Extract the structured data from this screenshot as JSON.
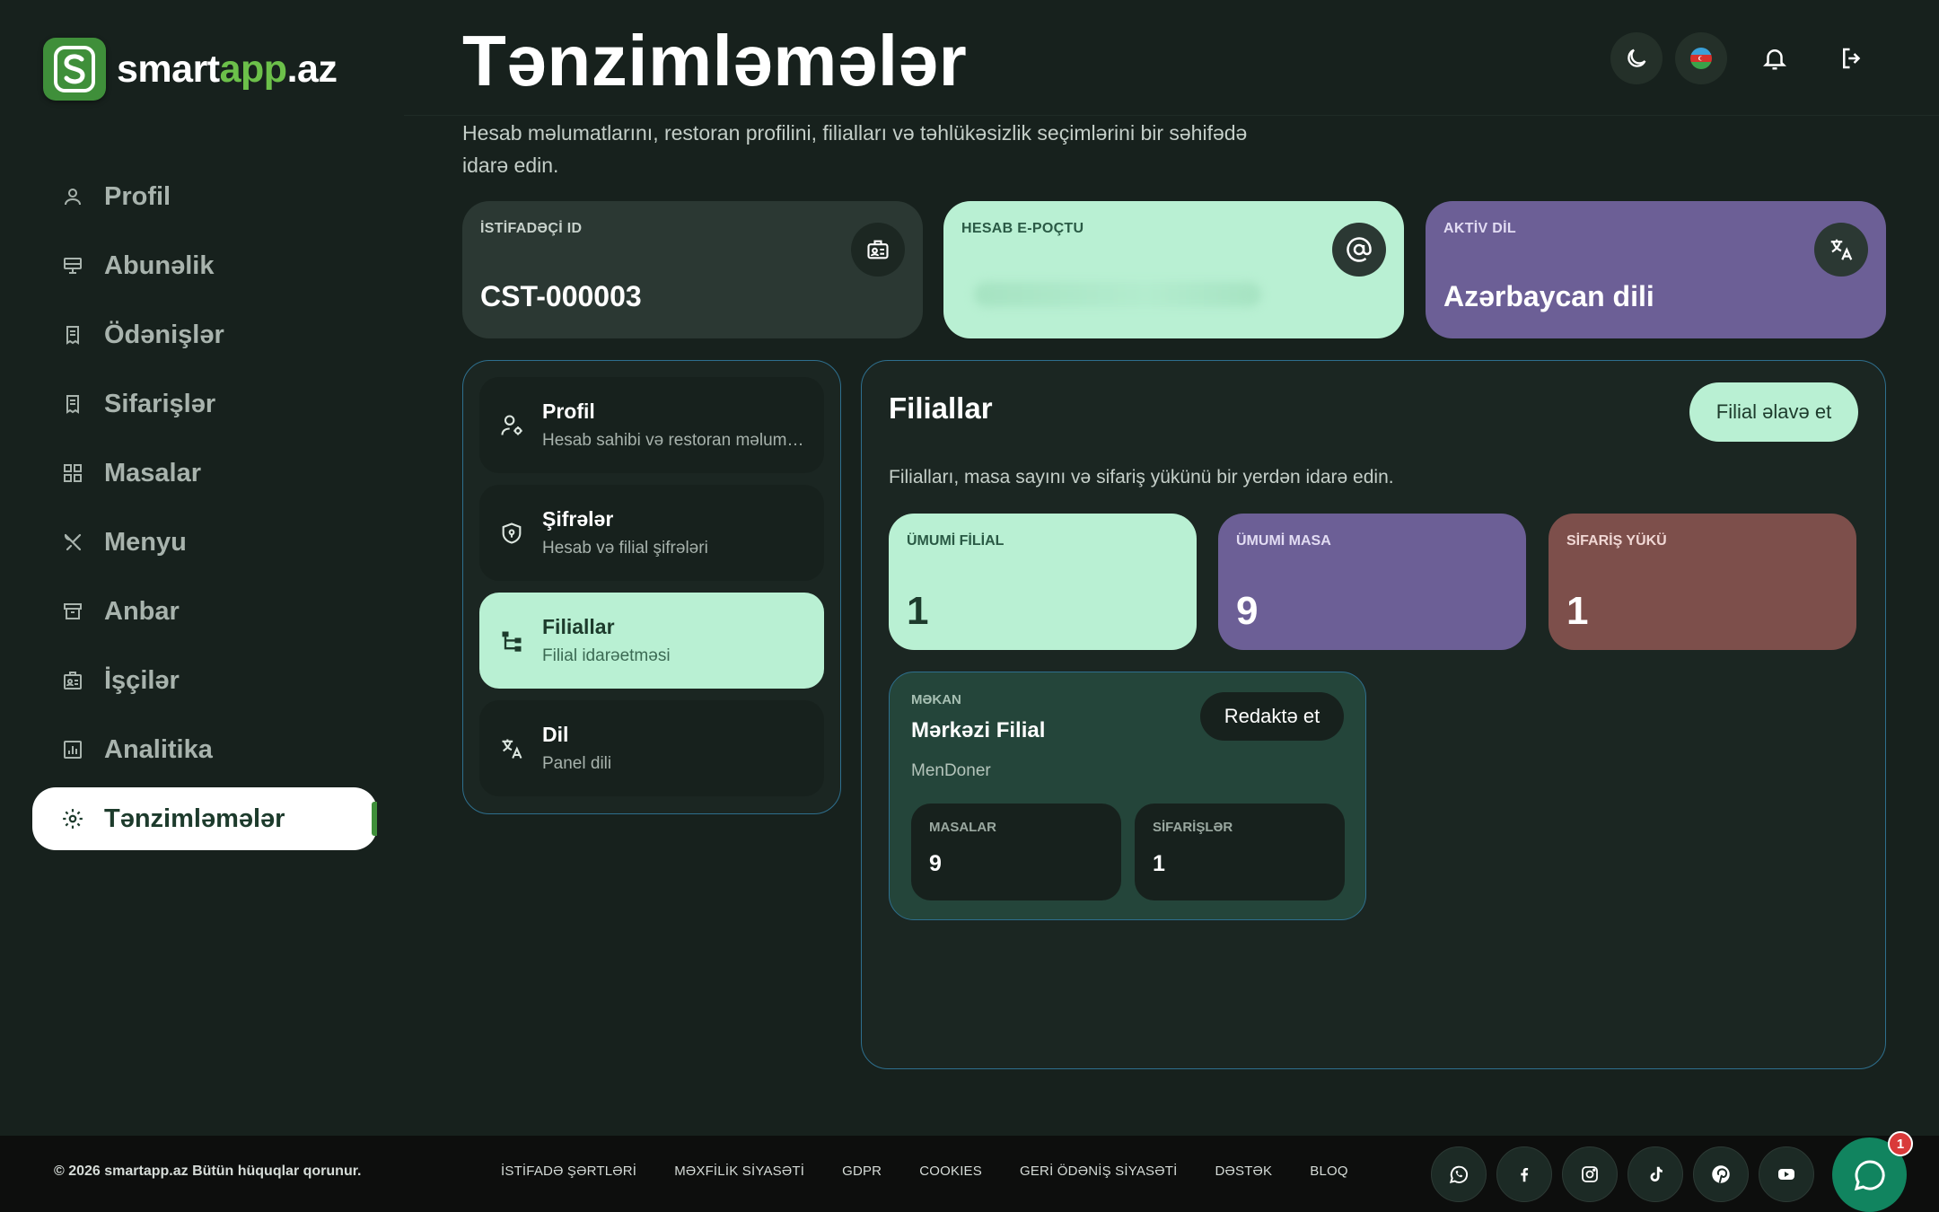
{
  "brand": {
    "name_part1": "smart",
    "name_part2": "app",
    "name_part3": ".az",
    "accent_color": "#6cc04a"
  },
  "sidebar": {
    "items": [
      {
        "label": "Profil",
        "icon": "user-icon"
      },
      {
        "label": "Abunəlik",
        "icon": "monitor-icon"
      },
      {
        "label": "Ödənişlər",
        "icon": "receipt-icon"
      },
      {
        "label": "Sifarişlər",
        "icon": "receipt-icon"
      },
      {
        "label": "Masalar",
        "icon": "grid-icon"
      },
      {
        "label": "Menyu",
        "icon": "utensils-icon"
      },
      {
        "label": "Anbar",
        "icon": "archive-icon"
      },
      {
        "label": "İşçilər",
        "icon": "id-badge-icon"
      },
      {
        "label": "Analitika",
        "icon": "chart-icon"
      },
      {
        "label": "Tənzimləmələr",
        "icon": "gear-icon",
        "active": true
      }
    ]
  },
  "header": {
    "title": "Tənzimləmələr",
    "subtitle": "Hesab məlumatlarını, restoran profilini, filialları və təhlükəsizlik seçimlərini bir səhifədə idarə edin.",
    "icons": [
      "moon-icon",
      "azerbaijan-flag-icon",
      "bell-icon",
      "logout-icon"
    ]
  },
  "stats": {
    "user_id": {
      "caption": "İSTİFADƏÇİ ID",
      "value": "CST-000003",
      "icon": "id-card-icon"
    },
    "email": {
      "caption": "HESAB E-POÇTU",
      "value": "",
      "icon": "at-icon"
    },
    "language": {
      "caption": "AKTİV DİL",
      "value": "Azərbaycan dili",
      "icon": "translate-icon"
    }
  },
  "settings_menu": [
    {
      "title": "Profil",
      "subtitle": "Hesab sahibi və restoran məlumatları",
      "icon": "user-gear-icon"
    },
    {
      "title": "Şifrələr",
      "subtitle": "Hesab və filial şifrələri",
      "icon": "shield-icon"
    },
    {
      "title": "Filiallar",
      "subtitle": "Filial idarəetməsi",
      "icon": "branches-icon",
      "active": true
    },
    {
      "title": "Dil",
      "subtitle": "Panel dili",
      "icon": "translate-icon"
    }
  ],
  "branches": {
    "title": "Filiallar",
    "add_button": "Filial əlavə et",
    "description": "Filialları, masa sayını və sifariş yükünü bir yerdən idarə edin.",
    "summary": [
      {
        "caption": "ÜMUMİ FİLİAL",
        "value": "1"
      },
      {
        "caption": "ÜMUMİ MASA",
        "value": "9"
      },
      {
        "caption": "SİFARİŞ YÜKÜ",
        "value": "1"
      }
    ],
    "card": {
      "caption": "MƏKAN",
      "name": "Mərkəzi Filial",
      "restaurant": "MenDoner",
      "edit_button": "Redaktə et",
      "tables_caption": "MASALAR",
      "tables_value": "9",
      "orders_caption": "SİFARİŞLƏR",
      "orders_value": "1"
    }
  },
  "footer": {
    "copyright": "© 2026 smartapp.az Bütün hüquqlar qorunur.",
    "links": [
      "İSTİFADƏ ŞƏRTLƏRİ",
      "MƏXFİLİK SİYASƏTİ",
      "GDPR",
      "COOKIES",
      "GERİ ÖDƏNİŞ SİYASƏTİ",
      "DƏSTƏK",
      "BLOQ"
    ],
    "socials": [
      "whatsapp-icon",
      "facebook-icon",
      "instagram-icon",
      "tiktok-icon",
      "pinterest-icon",
      "youtube-icon"
    ],
    "chat_badge": "1"
  },
  "colors": {
    "background": "#17211d",
    "mint": "#b9f0d3",
    "purple": "#6c5f96",
    "rose": "#7d4f4b",
    "panel_border": "#2e6f8e",
    "chat": "#11845f"
  }
}
